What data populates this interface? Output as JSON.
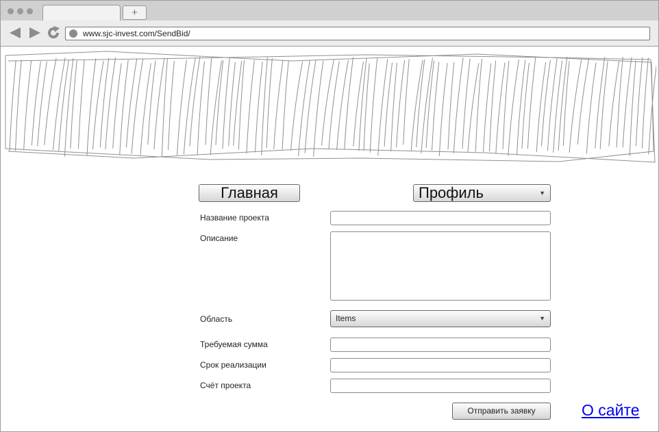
{
  "browser": {
    "address_url": "www.sjc-invest.com/SendBid/",
    "new_tab_symbol": "+"
  },
  "nav": {
    "home_label": "Главная",
    "profile_label": "Профиль"
  },
  "form": {
    "project_name_label": "Название проекта",
    "description_label": "Описание",
    "area_label": "Область",
    "area_selected": "Items",
    "amount_label": "Требуемая сумма",
    "term_label": "Срок реализации",
    "account_label": "Счёт проекта",
    "submit_label": "Отправить заявку"
  },
  "footer": {
    "about_label": "О сайте"
  },
  "icons": {
    "back": "back-arrow-icon",
    "forward": "forward-arrow-icon",
    "reload": "reload-icon",
    "caret": "chevron-down-icon"
  }
}
